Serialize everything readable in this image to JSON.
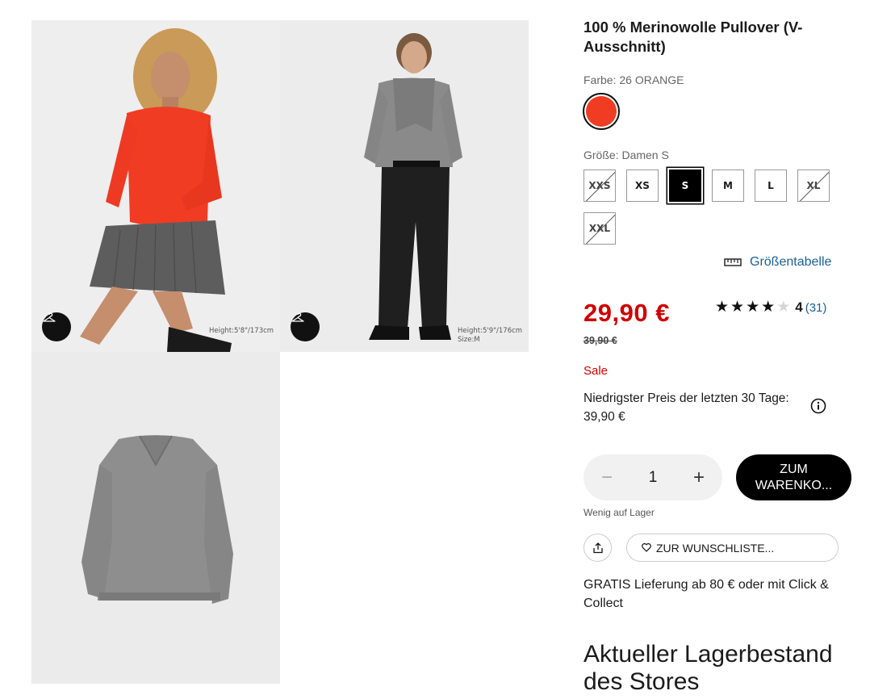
{
  "gallery": {
    "photo1": {
      "model_info": "Height:5'8\"/173cm"
    },
    "photo2": {
      "model_info_1": "Height:5'9\"/176cm",
      "model_info_2": "Size:M"
    }
  },
  "product": {
    "title": "100 % Merinowolle Pullover (V-Ausschnitt)",
    "color_label": "Farbe: 26 ORANGE",
    "color_swatch_hex": "#f03c23",
    "size_label": "Größe: Damen S",
    "sizes": [
      {
        "label": "XXS",
        "state": "unavailable"
      },
      {
        "label": "XS",
        "state": "available"
      },
      {
        "label": "S",
        "state": "selected"
      },
      {
        "label": "M",
        "state": "available"
      },
      {
        "label": "L",
        "state": "available"
      },
      {
        "label": "XL",
        "state": "unavailable"
      },
      {
        "label": "XXL",
        "state": "unavailable"
      }
    ],
    "size_chart_label": "Größentabelle",
    "price": "29,90 €",
    "old_price": "39,90 €",
    "rating": {
      "stars": 4,
      "value": "4",
      "count": "(31)"
    },
    "sale_label": "Sale",
    "lowest_price_text": "Niedrigster Preis der letzten 30 Tage: 39,90 €",
    "quantity": "1",
    "cart_button": "ZUM WARENKO...",
    "stock_note": "Wenig auf Lager",
    "wishlist_button": "ZUR WUNSCHLISTE...",
    "delivery_text": "GRATIS Lieferung ab 80 € oder mit Click & Collect",
    "stores_heading": "Aktueller Lagerbestand des Stores"
  },
  "colors": {
    "sale_red": "#d10000",
    "link_blue": "#1a6196",
    "black": "#000000"
  }
}
